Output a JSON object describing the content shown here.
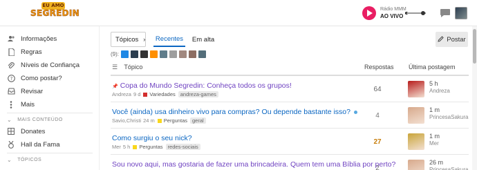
{
  "header": {
    "logo_top": "EU AMO",
    "logo_main": "SEGREDIN",
    "radio_label": "Rádio MMM",
    "radio_status": "AO VIVO"
  },
  "sidebar": {
    "items": [
      {
        "label": "Informações",
        "icon": "users-icon"
      },
      {
        "label": "Regras",
        "icon": "file-icon"
      },
      {
        "label": "Níveis de Confiança",
        "icon": "paperclip-icon"
      },
      {
        "label": "Como postar?",
        "icon": "help-icon"
      },
      {
        "label": "Revisar",
        "icon": "inbox-icon"
      },
      {
        "label": "Mais",
        "icon": "more-icon"
      }
    ],
    "section_more": "MAIS CONTEÚDO",
    "more_items": [
      {
        "label": "Donates",
        "icon": "grid-icon"
      },
      {
        "label": "Hall da Fama",
        "icon": "medal-icon"
      }
    ],
    "section_topics": "TÓPICOS"
  },
  "nav": {
    "topics_button": "Tópicos",
    "tab_recent": "Recentes",
    "tab_trending": "Em alta",
    "post_button": "Postar"
  },
  "online": {
    "count_label": "(9):",
    "avatar_colors": [
      "#1e88e5",
      "#2c3e50",
      "#333333",
      "#ff8f00",
      "#607d8b",
      "#9e9e9e",
      "#a1887f",
      "#8d6e63",
      "#546e7a"
    ]
  },
  "table": {
    "col_topic": "Tópico",
    "col_replies": "Respostas",
    "col_last": "Última postagem",
    "rows": [
      {
        "title": "Copa do Mundo Segredin: Conheça todos os grupos!",
        "pinned": true,
        "author": "Andreza",
        "age": "9 d",
        "category": "Variedades",
        "category_color": "#d32f2f",
        "tag": "andreza-games",
        "replies": "64",
        "last_time": "5 h",
        "last_user": "Andreza",
        "avatar_color": "#b71c1c"
      },
      {
        "title": "Você (ainda) usa dinheiro vivo para compras? Ou depende bastante isso?",
        "pinned": false,
        "author": "Savio,Christi",
        "age": "24 m",
        "category": "Perguntas",
        "category_color": "#f9d71c",
        "tag": "geral",
        "replies": "4",
        "last_time": "1 m",
        "last_user": "PrincesaSakura",
        "avatar_color": "#d7a98c"
      },
      {
        "title": "Como surgiu o seu nick?",
        "pinned": false,
        "author": "Mer",
        "age": "5 h",
        "category": "Perguntas",
        "category_color": "#f9d71c",
        "tag": "redes-sociais",
        "replies": "27",
        "last_time": "1 m",
        "last_user": "Mer",
        "avatar_color": "#c9a53a"
      },
      {
        "title": "Sou novo aqui, mas gostaria de fazer uma brincadeira. Quem tem uma Bíblia por perto?",
        "pinned": false,
        "author": "",
        "age": "",
        "category": "",
        "category_color": "",
        "tag": "",
        "replies": "2",
        "last_time": "26 m",
        "last_user": "PrincesaSakura",
        "avatar_color": "#d7a98c"
      }
    ]
  }
}
